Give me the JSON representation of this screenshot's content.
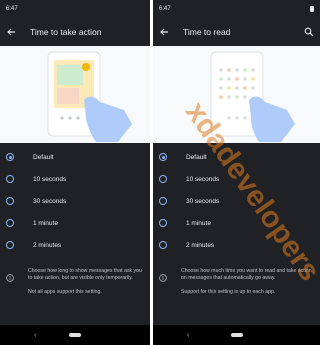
{
  "left": {
    "status": {
      "time": "6:47"
    },
    "title": "Time to take action",
    "options": [
      {
        "label": "Default",
        "checked": true
      },
      {
        "label": "10 seconds",
        "checked": false
      },
      {
        "label": "30 seconds",
        "checked": false
      },
      {
        "label": "1 minute",
        "checked": false
      },
      {
        "label": "2 minutes",
        "checked": false
      }
    ],
    "info_lines": [
      "Choose how long to show messages that ask you to take action, but are visible only temporarily.",
      "Not all apps support this setting."
    ]
  },
  "right": {
    "status": {
      "time": "6:47"
    },
    "title": "Time to read",
    "options": [
      {
        "label": "Default",
        "checked": true
      },
      {
        "label": "10 seconds",
        "checked": false
      },
      {
        "label": "30 seconds",
        "checked": false
      },
      {
        "label": "1 minute",
        "checked": false
      },
      {
        "label": "2 minutes",
        "checked": false
      }
    ],
    "info_lines": [
      "Choose how much time you want to read and take action on messages that automatically go away.",
      "Support for this setting is up to each app."
    ]
  },
  "watermark": {
    "text": "xdadevelopers"
  },
  "colors": {
    "background": "#202124",
    "accent": "#8ab4f8",
    "watermark": "#e07a1f"
  },
  "icons": [
    "back-arrow-icon",
    "search-icon",
    "info-icon",
    "battery-icon",
    "nav-back-icon",
    "home-pill-icon"
  ]
}
